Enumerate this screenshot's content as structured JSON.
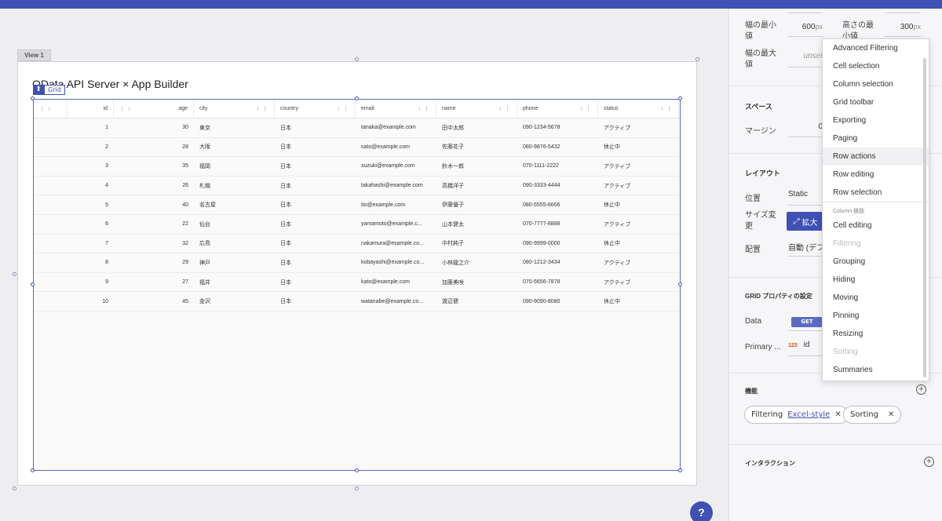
{
  "view_tab": "View 1",
  "heading": "OData API Server × App Builder",
  "grid_badge": "Grid",
  "columns": [
    "id",
    "age",
    "city",
    "country",
    "email",
    "name",
    "phone",
    "status"
  ],
  "rows": [
    {
      "id": "1",
      "age": "30",
      "city": "東京",
      "country": "日本",
      "email": "tanaka@example.com",
      "name": "田中太郎",
      "phone": "090-1234-5678",
      "status": "アクティブ"
    },
    {
      "id": "2",
      "age": "28",
      "city": "大阪",
      "country": "日本",
      "email": "sato@example.com",
      "name": "佐藤花子",
      "phone": "080-9876-5432",
      "status": "休止中"
    },
    {
      "id": "3",
      "age": "35",
      "city": "福岡",
      "country": "日本",
      "email": "suzuki@example.com",
      "name": "鈴木一郎",
      "phone": "070-1111-2222",
      "status": "アクティブ"
    },
    {
      "id": "4",
      "age": "26",
      "city": "札幌",
      "country": "日本",
      "email": "takahashi@example.com",
      "name": "高橋洋子",
      "phone": "090-3333-4444",
      "status": "アクティブ"
    },
    {
      "id": "5",
      "age": "40",
      "city": "名古屋",
      "country": "日本",
      "email": "ito@example.com",
      "name": "伊藤優子",
      "phone": "080-5555-6666",
      "status": "休止中"
    },
    {
      "id": "6",
      "age": "22",
      "city": "仙台",
      "country": "日本",
      "email": "yamamoto@example.c...",
      "name": "山本健太",
      "phone": "070-7777-8888",
      "status": "アクティブ"
    },
    {
      "id": "7",
      "age": "32",
      "city": "広島",
      "country": "日本",
      "email": "nakamura@example.co...",
      "name": "中村純子",
      "phone": "090-9999-0000",
      "status": "休止中"
    },
    {
      "id": "8",
      "age": "29",
      "city": "神戸",
      "country": "日本",
      "email": "kobayashi@example.co...",
      "name": "小林龍之介",
      "phone": "080-1212-3434",
      "status": "アクティブ"
    },
    {
      "id": "9",
      "age": "27",
      "city": "福井",
      "country": "日本",
      "email": "kato@example.com",
      "name": "加藤美咲",
      "phone": "070-5656-7878",
      "status": "アクティブ"
    },
    {
      "id": "10",
      "age": "45",
      "city": "金沢",
      "country": "日本",
      "email": "watanabe@example.co...",
      "name": "渡辺健",
      "phone": "090-9090-8080",
      "status": "休止中"
    }
  ],
  "panel": {
    "min_width_label": "幅の最小値",
    "min_width_value": "600",
    "min_width_unit": "px",
    "min_height_label": "高さの最小値",
    "min_height_value": "300",
    "min_height_unit": "px",
    "max_width_label": "幅の最大値",
    "max_width_value": "unset",
    "space_title": "スペース",
    "margin_label": "マージン",
    "margin_value": "0",
    "layout_title": "レイアウト",
    "position_label": "位置",
    "position_value": "Static",
    "resize_label": "サイズ変更",
    "resize_button": "拡大",
    "placement_label": "配置",
    "placement_value": "自動 (デフ",
    "grid_props_title": "GRID プロパティの設定",
    "data_label": "Data",
    "data_method": "GET",
    "primary_label": "Primary ...",
    "primary_type": "123",
    "primary_value": "id",
    "features_title": "機能",
    "chip_filtering_label": "Filtering",
    "chip_filtering_link": "Excel-style",
    "chip_sorting_label": "Sorting",
    "interaction_title": "インタラクション"
  },
  "dropdown": {
    "grid_items": [
      "Advanced Filtering",
      "Cell selection",
      "Column selection",
      "Grid toolbar",
      "Exporting",
      "Paging",
      "Row actions",
      "Row editing",
      "Row selection"
    ],
    "group_label": "Column 機能",
    "column_items": [
      "Cell editing",
      "Filtering",
      "Grouping",
      "Hiding",
      "Moving",
      "Pinning",
      "Resizing",
      "Sorting",
      "Summaries"
    ],
    "disabled_items": [
      "Filtering",
      "Sorting"
    ],
    "hover_item": "Row actions"
  },
  "help_label": "?",
  "colors": {
    "accent": "#3f51b5",
    "selection": "#5c6bc0"
  }
}
